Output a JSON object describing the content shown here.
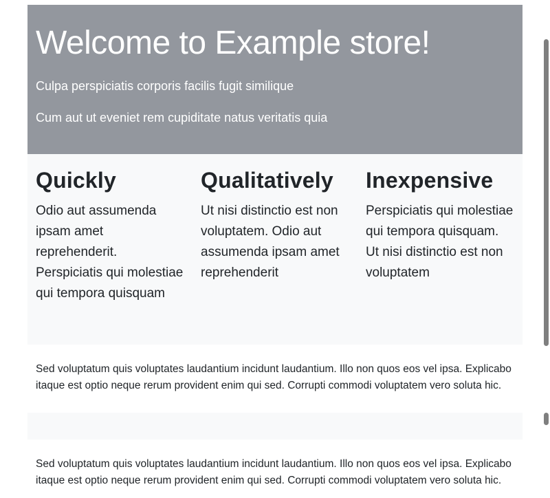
{
  "hero": {
    "title": "Welcome to Example store!",
    "subtitle_1": "Culpa perspiciatis corporis facilis fugit similique",
    "subtitle_2": "Cum aut ut eveniet rem cupiditate natus veritatis quia"
  },
  "features": [
    {
      "heading": "Quickly",
      "text": "Odio aut assumenda ipsam amet reprehenderit. Perspiciatis qui molestiae qui tempora quisquam"
    },
    {
      "heading": "Qualitatively",
      "text": "Ut nisi distinctio est non voluptatem. Odio aut assumenda ipsam amet reprehenderit"
    },
    {
      "heading": "Inexpensive",
      "text": "Perspiciatis qui molestiae qui tempora quisquam. Ut nisi distinctio est non voluptatem"
    }
  ],
  "content_blocks": [
    {
      "text": "Sed voluptatum quis voluptates laudantium incidunt laudantium. Illo non quos eos vel ipsa. Explicabo itaque est optio neque rerum provident enim qui sed. Corrupti commodi voluptatem vero soluta hic."
    },
    {
      "text": "Sed voluptatum quis voluptates laudantium incidunt laudantium. Illo non quos eos vel ipsa. Explicabo itaque est optio neque rerum provident enim qui sed. Corrupti commodi voluptatem vero soluta hic."
    }
  ],
  "colors": {
    "hero_background": "#93979e",
    "feature_background": "#f8f9fa",
    "text": "#212529"
  }
}
